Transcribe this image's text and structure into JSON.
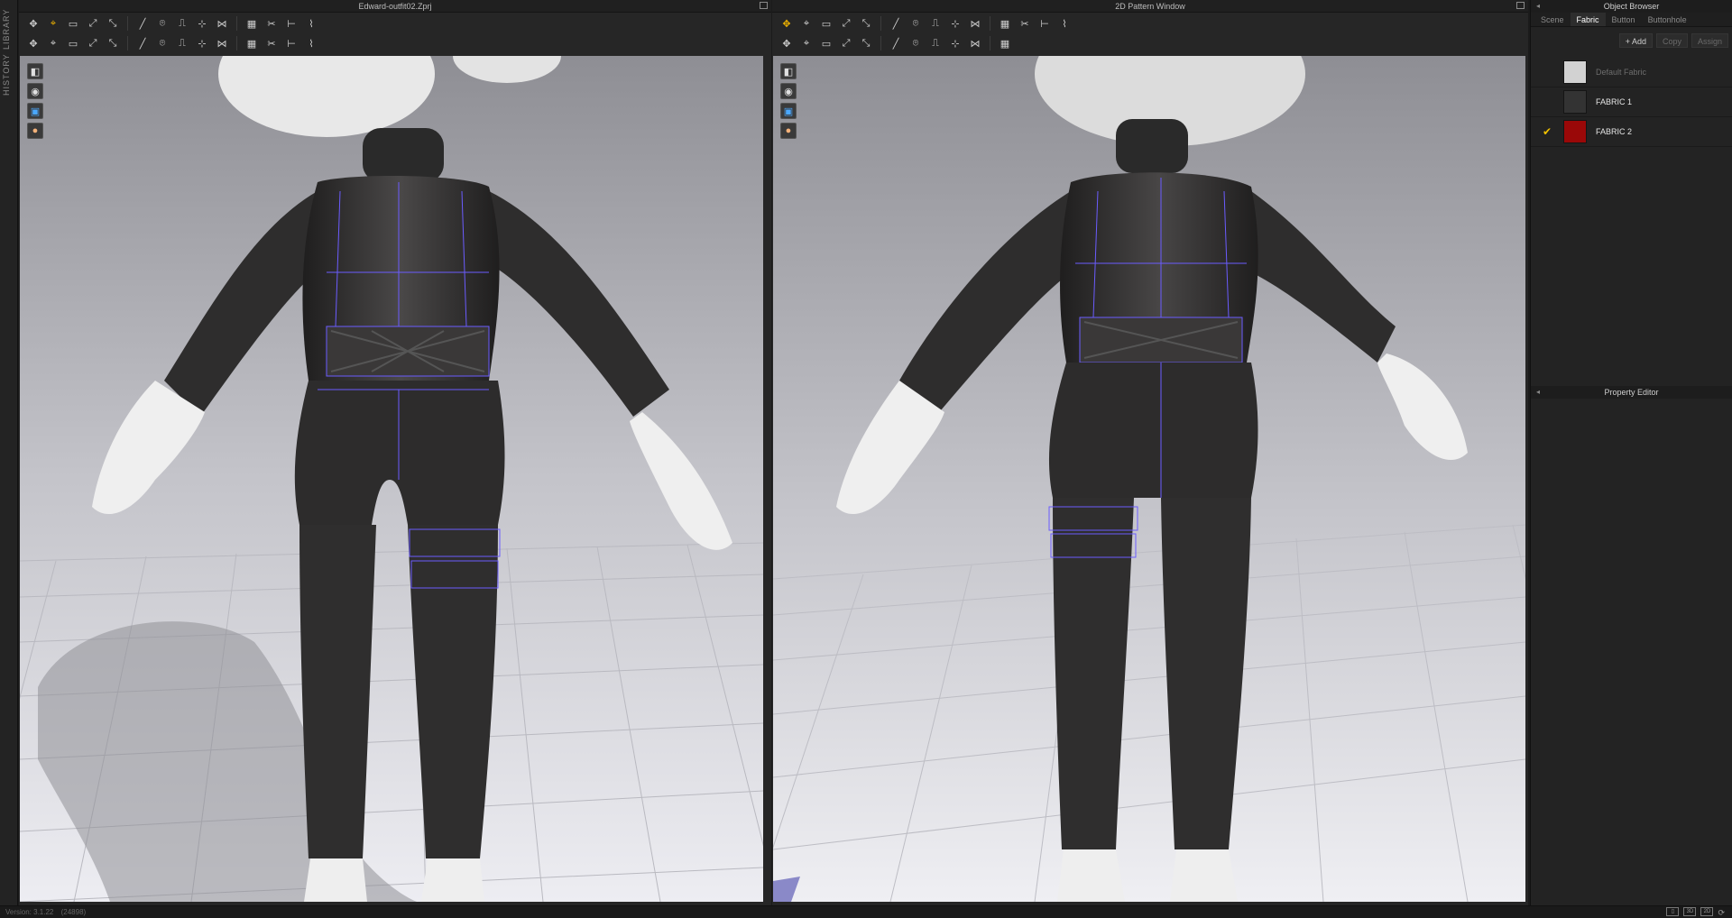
{
  "side_strip": {
    "tabs": [
      "LIBRARY",
      "HISTORY"
    ]
  },
  "left_window": {
    "title": "Edward-outfit02.Zprj",
    "toolbar_row1": [
      "move-icon",
      "select-icon",
      "box-select-icon",
      "transform-icon",
      "scale-icon",
      "line-tool-icon",
      "pin-icon",
      "fold-icon",
      "tack-icon",
      "strap-icon",
      "cloth-icon",
      "cut-icon",
      "measure-icon",
      "brush-icon"
    ],
    "toolbar_row2": [
      "avatar-icon",
      "stitch-icon",
      "pin-arrange-icon",
      "seam-icon",
      "pattern-icon",
      "puckering-icon",
      "button-icon",
      "ruler-icon",
      "zoom-icon",
      "layout-icon",
      "align-icon",
      "garment-front-icon",
      "garment-back-icon",
      "fit-icon"
    ]
  },
  "right_window": {
    "title": "2D Pattern Window",
    "toolbar_row1": [
      "select-icon",
      "transform-icon",
      "edit-point-icon",
      "curve-icon",
      "add-point-icon",
      "polygon-icon",
      "rectangle-icon",
      "circle-icon",
      "internal-line-icon",
      "internal-rect-icon",
      "internal-circle-icon",
      "dart-icon",
      "fold-icon",
      "notch-icon"
    ],
    "toolbar_row2": [
      "segment-sewing-icon",
      "free-sewing-icon",
      "check-sewing-icon",
      "tape-icon",
      "fabric-icon",
      "texture-icon",
      "graphic-icon",
      "button-icon",
      "buttonhole-icon",
      "topstitch-icon",
      "print-icon"
    ]
  },
  "viewport_tools": [
    "camera-icon",
    "avatar-display-icon",
    "fabric-display-icon",
    "skin-icon"
  ],
  "object_browser": {
    "title": "Object Browser",
    "tabs": [
      "Scene",
      "Fabric",
      "Button",
      "Buttonhole"
    ],
    "active_tab": "Fabric",
    "actions": {
      "add": "Add",
      "copy": "Copy",
      "assign": "Assign"
    },
    "fabrics": [
      {
        "name": "Default Fabric",
        "color": "#d2d2d2",
        "disabled": true,
        "selected": false
      },
      {
        "name": "FABRIC 1",
        "color": "#333333",
        "disabled": false,
        "selected": false
      },
      {
        "name": "FABRIC 2",
        "color": "#9a0808",
        "disabled": false,
        "selected": true
      }
    ]
  },
  "property_editor": {
    "title": "Property Editor"
  },
  "status_bar": {
    "version": "Version: 3.1.22",
    "build": "(24898)"
  },
  "colors": {
    "accent": "#f0b400",
    "outfit": "#2f2e2e",
    "seam_line": "#6b5cff",
    "stitch": "#7a3b3b",
    "floor": "#ececf1"
  }
}
